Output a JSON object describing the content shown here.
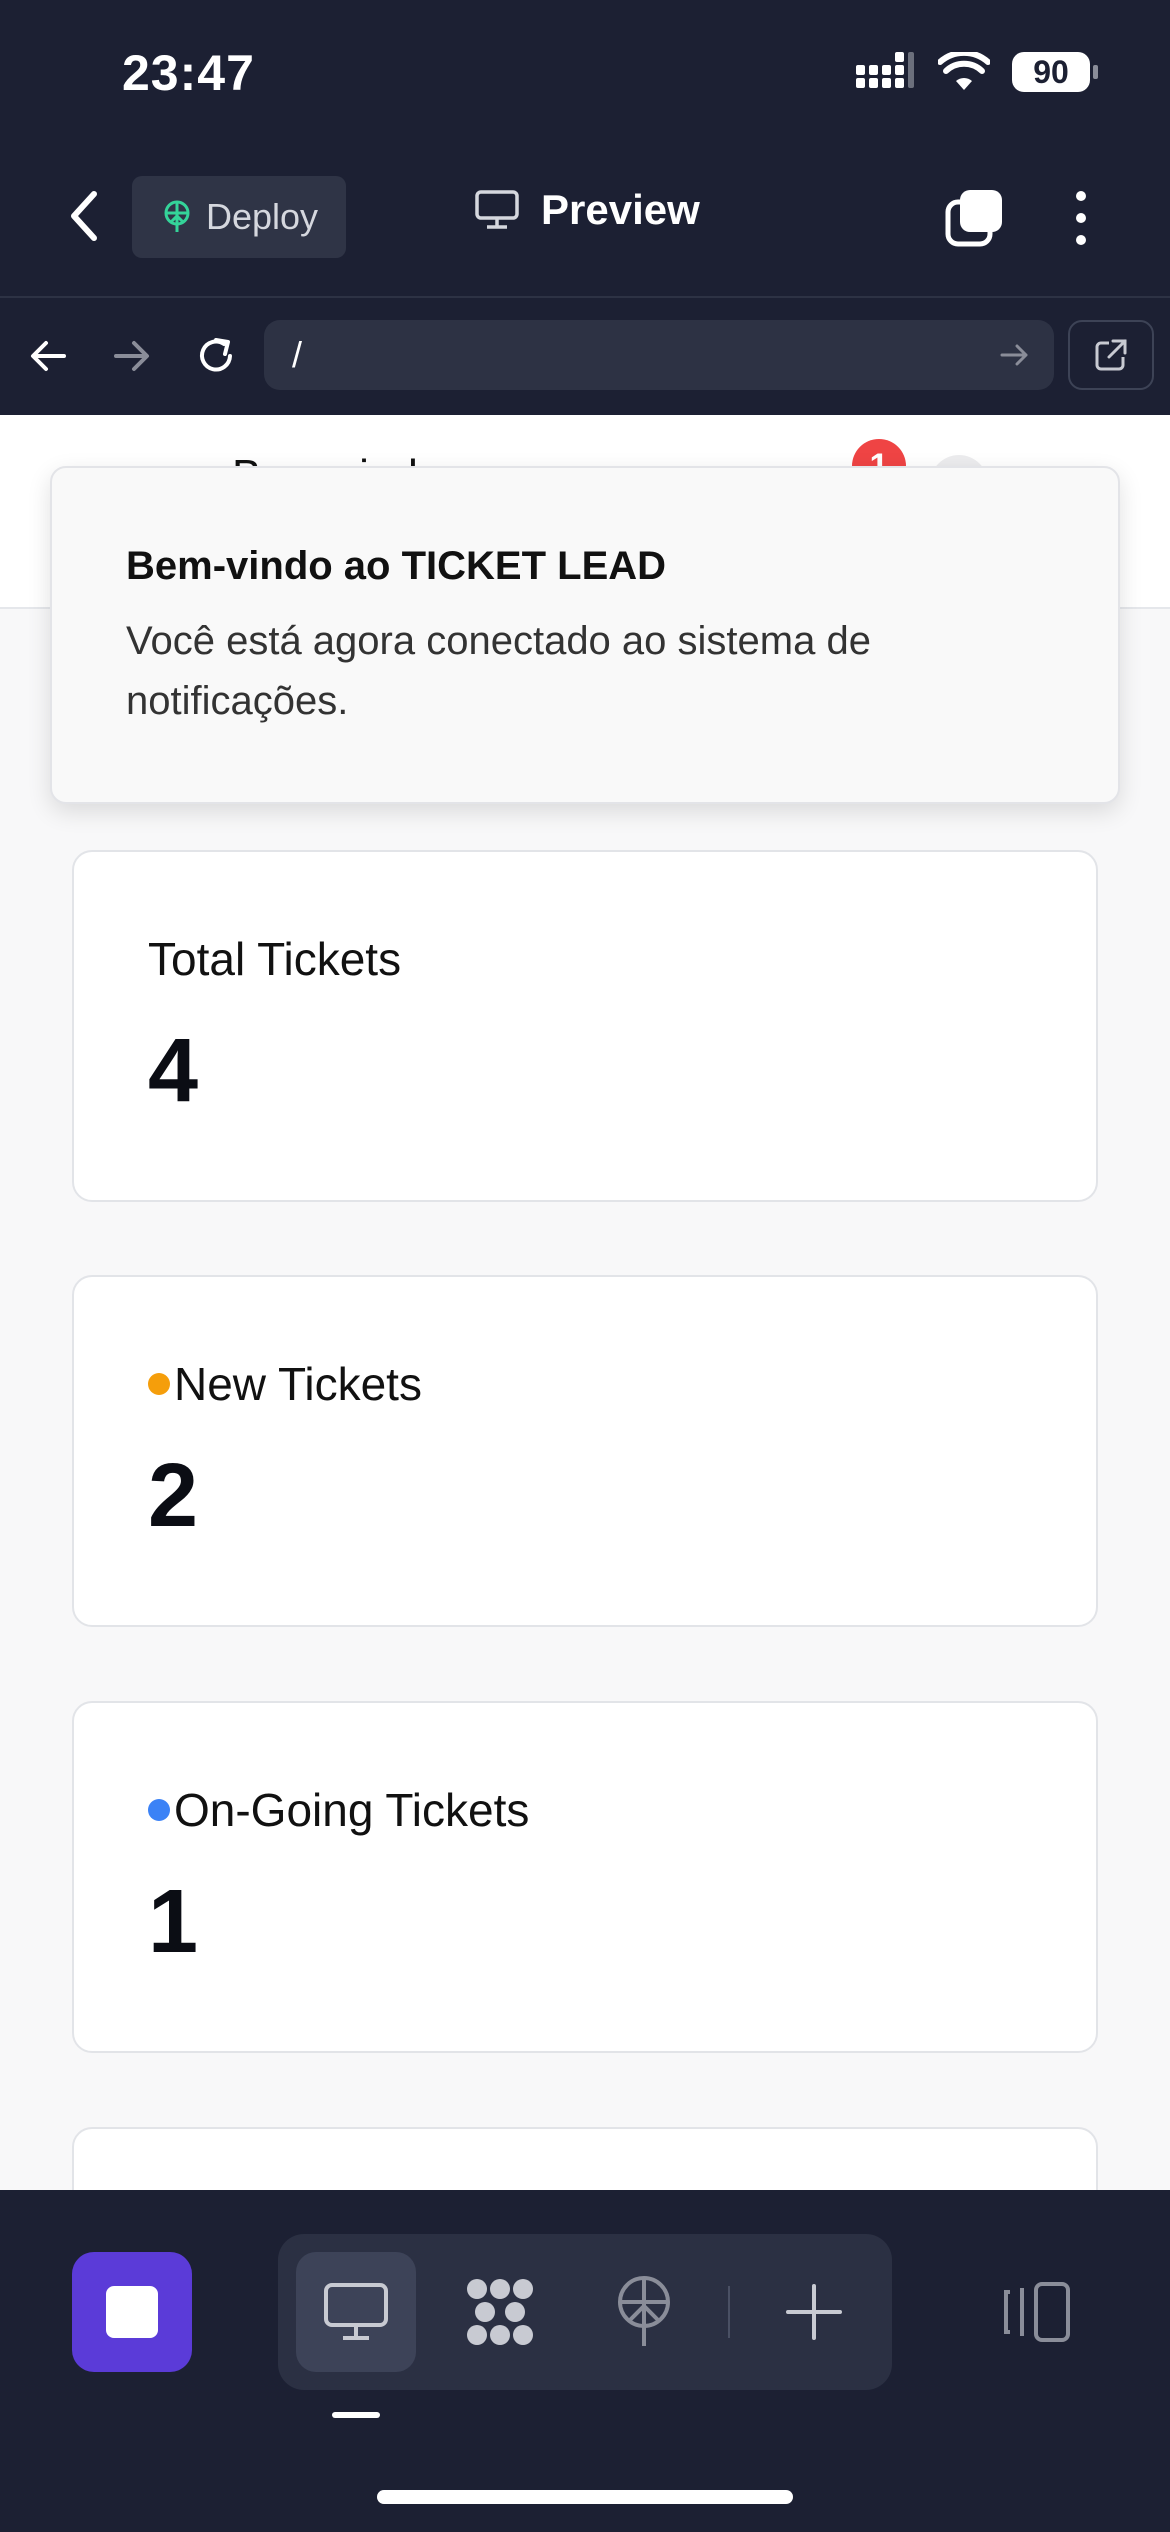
{
  "status_bar": {
    "time": "23:47",
    "battery": "90"
  },
  "toolbar": {
    "deploy_label": "Deploy",
    "preview_label": "Preview"
  },
  "url_bar": {
    "url": "/"
  },
  "page": {
    "header_partial_text": "Bem-vindo",
    "notification_count": "1",
    "toast": {
      "title": "Bem-vindo ao TICKET LEAD",
      "body": "Você está agora conectado ao sistema de notificações."
    },
    "cards": [
      {
        "label": "Total Tickets",
        "value": "4",
        "dot_color": ""
      },
      {
        "label": "New Tickets",
        "value": "2",
        "dot_color": "#f59e0b"
      },
      {
        "label": "On-Going Tickets",
        "value": "1",
        "dot_color": "#3b82f6"
      }
    ]
  },
  "colors": {
    "chrome_bg": "#1c2033",
    "accent_purple": "#5b3bd8",
    "notification_red": "#ef4444",
    "new_dot": "#f59e0b",
    "ongoing_dot": "#3b82f6"
  }
}
